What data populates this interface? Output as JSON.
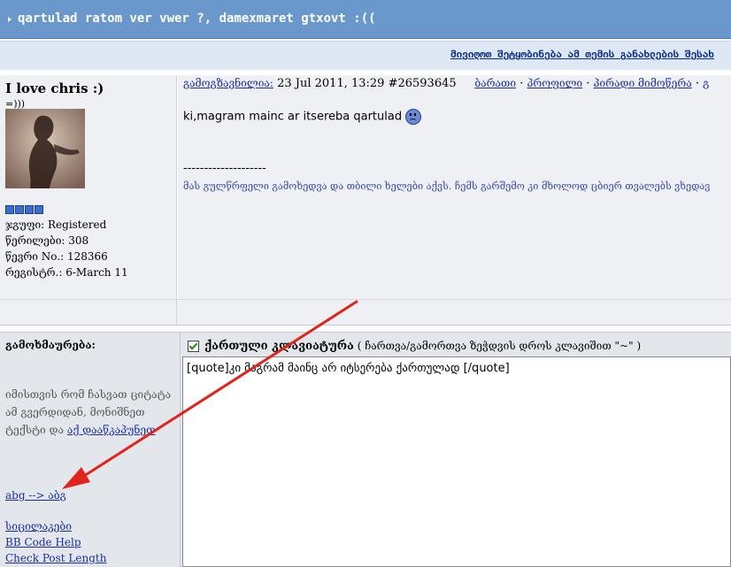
{
  "thread": {
    "title": "qartulad ratom ver vwer ?, damexmaret gtxovt :((",
    "subscribe_link": "მივიღოთ შეტყობინება ამ თემის განახლების შესახ"
  },
  "user": {
    "name": "I love chris :)",
    "subtitle": "=)))",
    "group": "ჯგუფი: Registered",
    "posts": "წერილები: 308",
    "member_no": "წევრი No.: 128366",
    "registered": "რეგისტრ.: 6-March 11"
  },
  "post": {
    "posted_label": "გამოგზავნილია:",
    "date": " 23 Jul 2011, 13:29  #26593645",
    "link_report": "ბარათი",
    "link_profile": "პროფილი",
    "link_pm": "პირადი მიმოწერა",
    "link_more": "გ",
    "body": "ki,magram mainc ar itsereba qartulad ",
    "sig_line": "--------------------",
    "signature": "მას გულწრფელი გამოხედვა და თბილი ხელები აქვს. ჩემს გარშემო კი მხოლოდ ცბიერ თვალებს ვხედავ"
  },
  "reply": {
    "label": "გამოხმაურება:",
    "hint_text": "იმისთვის რომ ჩასვათ ციტატა ამ გვერდიდან, მონიშნეთ ტექსტი და",
    "hint_link": "აქ დააწკაპუნეთ",
    "link_translit": "abg --> აბგ",
    "link_smilies": "სიცილაკები",
    "link_bbcode": "BB Code Help",
    "link_check": "Check Post Length",
    "kb_label": "ქართული კლავიატურა",
    "kb_hint": " ( ჩართვა/გამორთვა ზეჭდვის დროს კლავიშით \"~\" )",
    "textarea_value": "[quote]კი მაგრამ მაინც არ იტსერება ქართულად [/quote]"
  },
  "colors": {
    "title_bar": "#6a97cc",
    "annotation_arrow": "#e0241b"
  }
}
